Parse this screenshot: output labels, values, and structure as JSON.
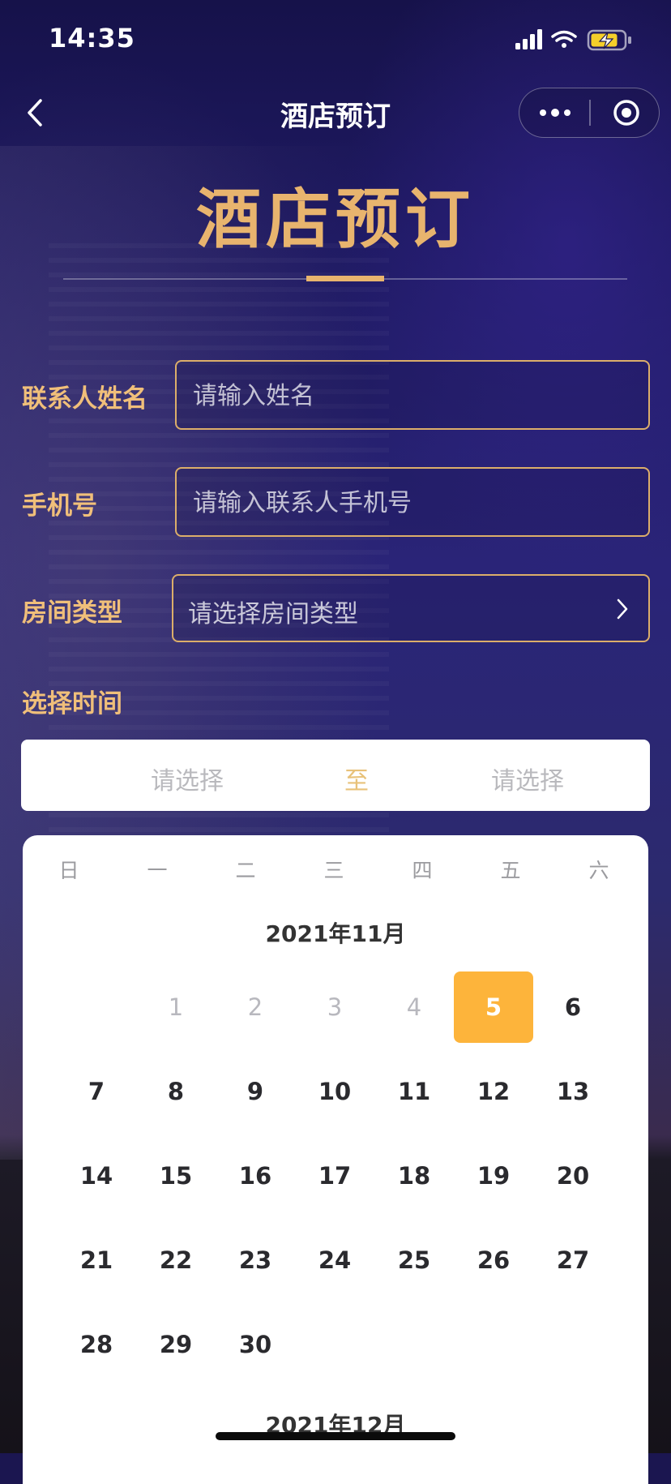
{
  "status_bar": {
    "time": "14:35"
  },
  "navbar": {
    "title": "酒店预订"
  },
  "hero": {
    "title": "酒店预订"
  },
  "form": {
    "name_label": "联系人姓名",
    "name_placeholder": "请输入姓名",
    "phone_label": "手机号",
    "phone_placeholder": "请输入联系人手机号",
    "room_label": "房间类型",
    "room_placeholder": "请选择房间类型",
    "time_label": "选择时间"
  },
  "date_range": {
    "start": "请选择",
    "separator": "至",
    "end": "请选择"
  },
  "calendar": {
    "weekdays": [
      "日",
      "一",
      "二",
      "三",
      "四",
      "五",
      "六"
    ],
    "month_title": "2021年11月",
    "next_month_title": "2021年12月",
    "days": [
      {
        "d": "1",
        "state": "past"
      },
      {
        "d": "2",
        "state": "past"
      },
      {
        "d": "3",
        "state": "past"
      },
      {
        "d": "4",
        "state": "past"
      },
      {
        "d": "5",
        "state": "selected"
      },
      {
        "d": "6",
        "state": "normal"
      },
      {
        "d": "7",
        "state": "normal"
      },
      {
        "d": "8",
        "state": "normal"
      },
      {
        "d": "9",
        "state": "normal"
      },
      {
        "d": "10",
        "state": "normal"
      },
      {
        "d": "11",
        "state": "normal"
      },
      {
        "d": "12",
        "state": "normal"
      },
      {
        "d": "13",
        "state": "normal"
      },
      {
        "d": "14",
        "state": "normal"
      },
      {
        "d": "15",
        "state": "normal"
      },
      {
        "d": "16",
        "state": "normal"
      },
      {
        "d": "17",
        "state": "normal"
      },
      {
        "d": "18",
        "state": "normal"
      },
      {
        "d": "19",
        "state": "normal"
      },
      {
        "d": "20",
        "state": "normal"
      },
      {
        "d": "21",
        "state": "normal"
      },
      {
        "d": "22",
        "state": "normal"
      },
      {
        "d": "23",
        "state": "normal"
      },
      {
        "d": "24",
        "state": "normal"
      },
      {
        "d": "25",
        "state": "normal"
      },
      {
        "d": "26",
        "state": "normal"
      },
      {
        "d": "27",
        "state": "normal"
      },
      {
        "d": "28",
        "state": "normal"
      },
      {
        "d": "29",
        "state": "normal"
      },
      {
        "d": "30",
        "state": "normal"
      }
    ],
    "first_weekday_index": 1
  },
  "colors": {
    "accent_gold": "#e8b46e",
    "selected_day": "#fdb43b",
    "background": "#1f1a63"
  },
  "icons": {
    "back": "chevron-left-icon",
    "more": "more-dots-icon",
    "close": "target-circle-icon",
    "select_arrow": "chevron-right-icon",
    "signal": "signal-icon",
    "wifi": "wifi-icon",
    "battery": "battery-charging-icon"
  }
}
